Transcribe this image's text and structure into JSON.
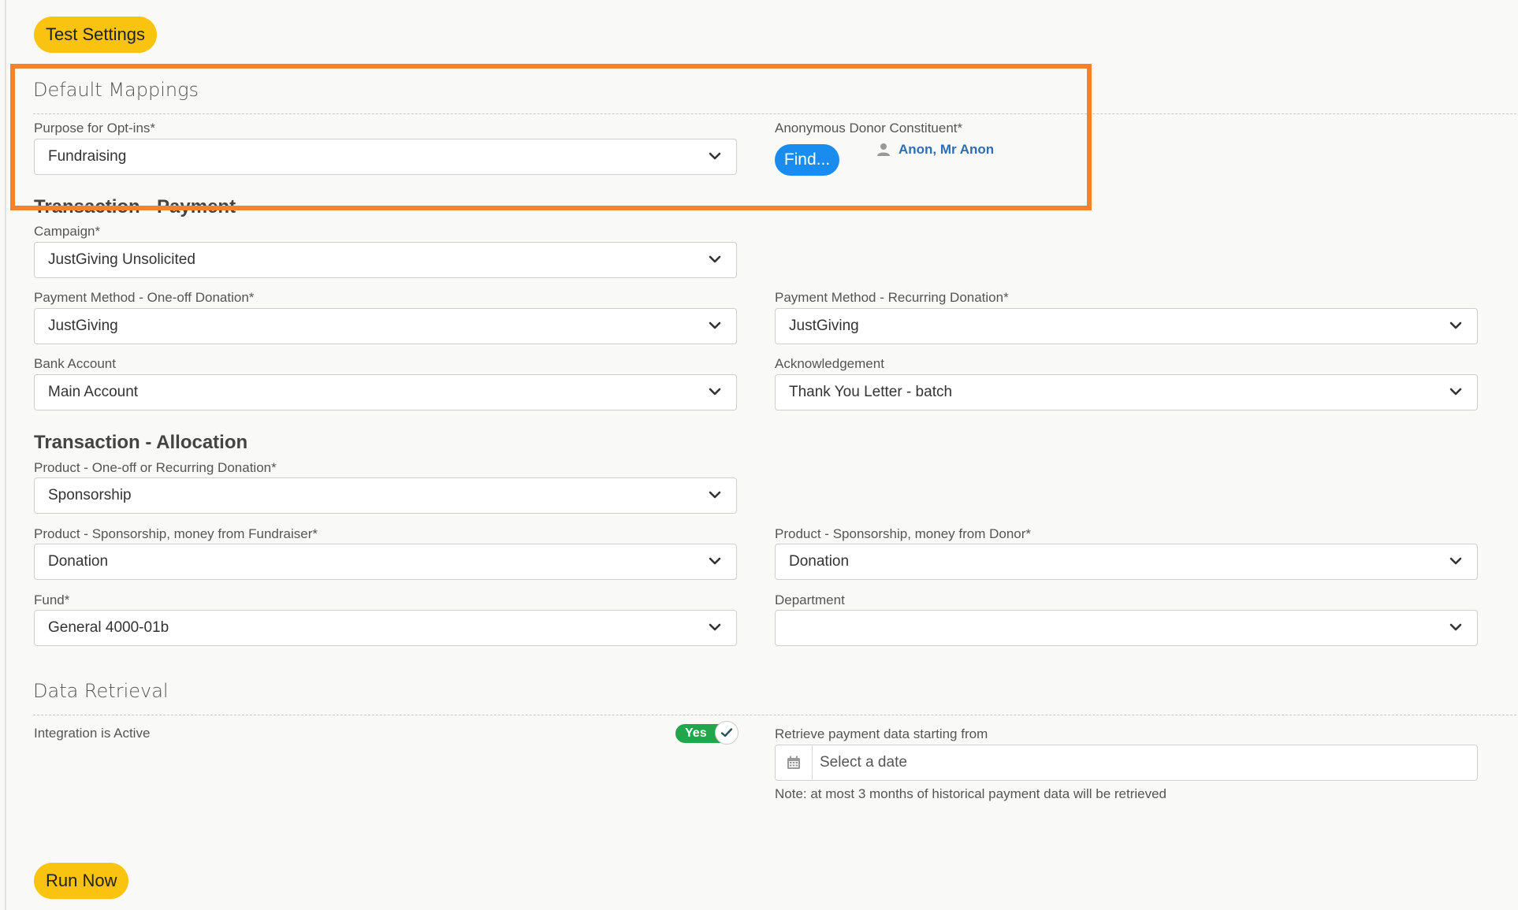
{
  "buttons": {
    "test_settings": "Test Settings",
    "run_now": "Run Now",
    "find": "Find..."
  },
  "default_mappings": {
    "title": "Default Mappings",
    "purpose_label": "Purpose for Opt-ins*",
    "purpose_value": "Fundraising",
    "donor_label": "Anonymous Donor Constituent*",
    "donor_name": "Anon, Mr Anon"
  },
  "transaction_payment": {
    "heading": "Transaction - Payment",
    "campaign_label": "Campaign*",
    "campaign_value": "JustGiving Unsolicited",
    "pm_oneoff_label": "Payment Method - One-off Donation*",
    "pm_oneoff_value": "JustGiving",
    "pm_recurring_label": "Payment Method - Recurring Donation*",
    "pm_recurring_value": "JustGiving",
    "bank_label": "Bank Account",
    "bank_value": "Main Account",
    "ack_label": "Acknowledgement",
    "ack_value": "Thank You Letter - batch"
  },
  "transaction_allocation": {
    "heading": "Transaction - Allocation",
    "product_label": "Product - One-off or Recurring Donation*",
    "product_value": "Sponsorship",
    "prod_fundraiser_label": "Product - Sponsorship, money from Fundraiser*",
    "prod_fundraiser_value": "Donation",
    "prod_donor_label": "Product - Sponsorship, money from Donor*",
    "prod_donor_value": "Donation",
    "fund_label": "Fund*",
    "fund_value": "General 4000-01b",
    "department_label": "Department",
    "department_value": ""
  },
  "data_retrieval": {
    "title": "Data Retrieval",
    "integration_label": "Integration is Active",
    "toggle_text": "Yes",
    "toggle_on": true,
    "retrieve_label": "Retrieve payment data starting from",
    "date_placeholder": "Select a date",
    "note": "Note: at most 3 months of historical payment data will be retrieved"
  },
  "colors": {
    "accent_yellow": "#f9c310",
    "find_blue": "#1a8cf0",
    "link_blue": "#2f6db5",
    "toggle_green": "#22a64b",
    "highlight_orange": "#f5812a"
  },
  "icons": {
    "dropdown": "chevron-down-icon",
    "donor": "person-icon",
    "toggle_check": "check-icon",
    "date": "calendar-icon"
  }
}
